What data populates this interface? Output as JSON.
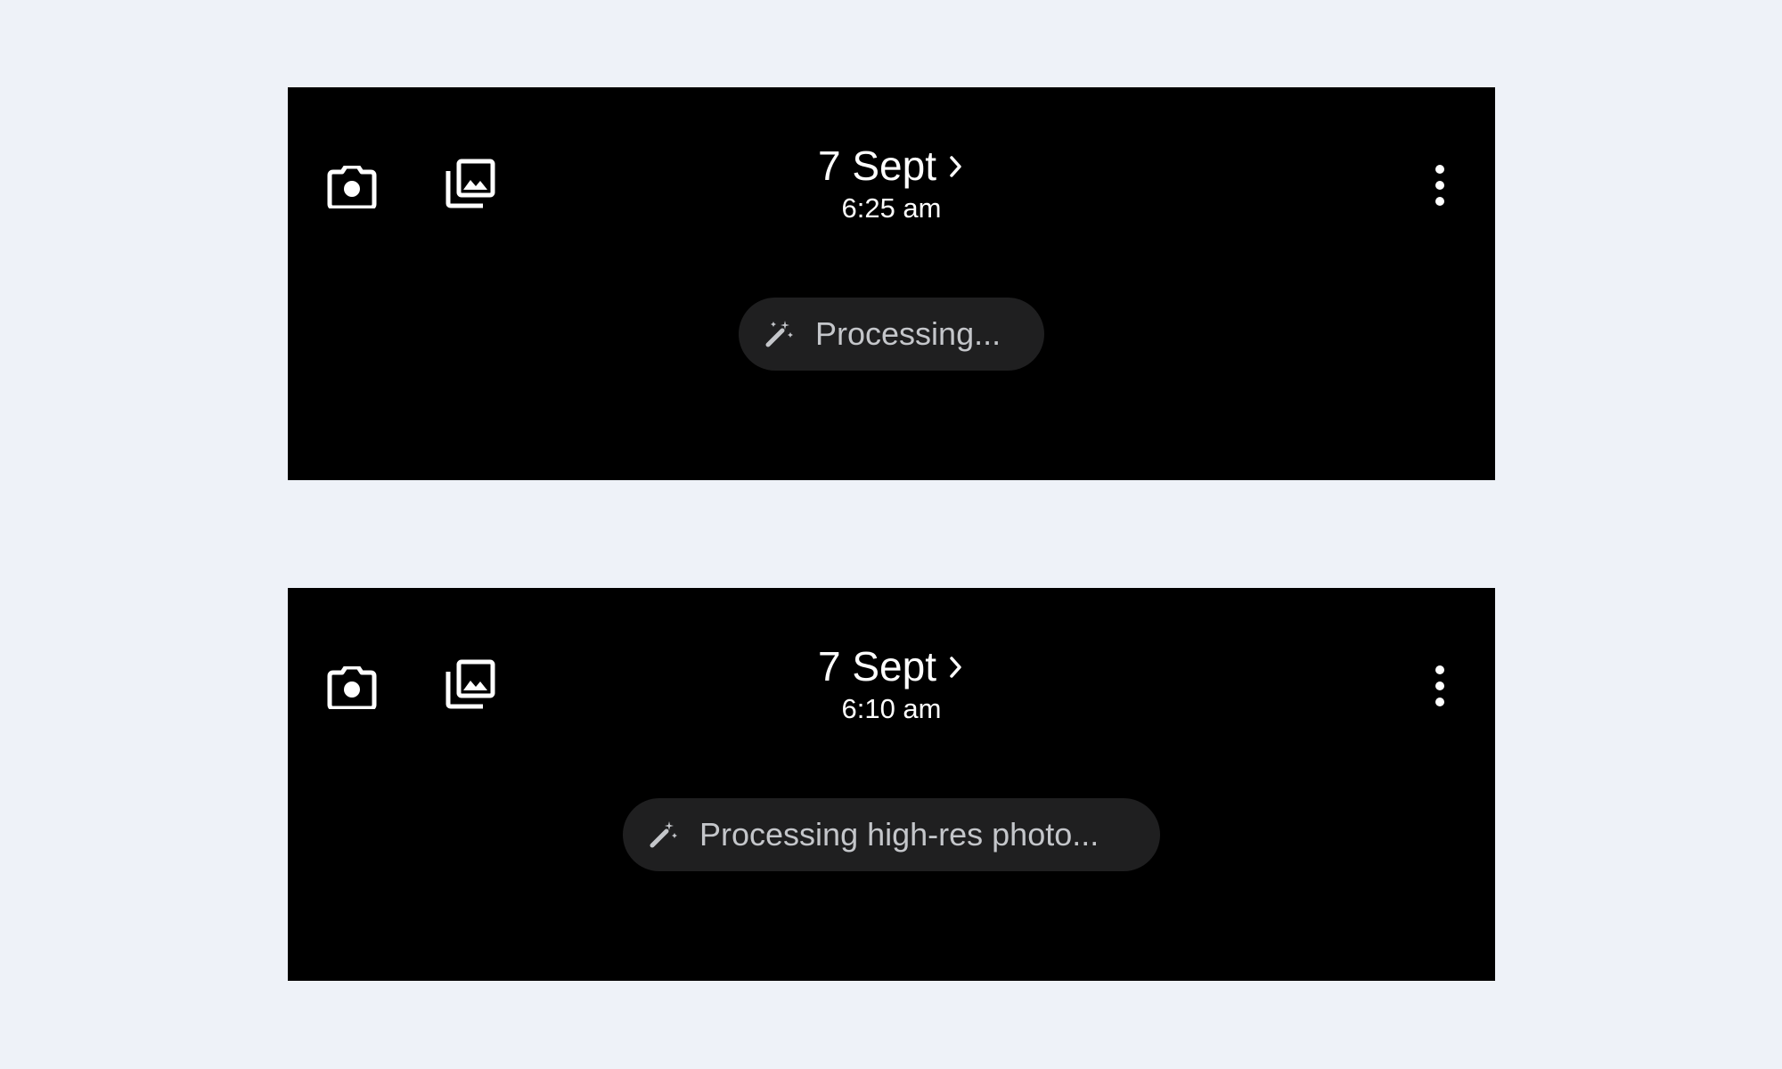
{
  "colors": {
    "page_background": "#eef2f8",
    "panel_background": "#000000",
    "pill_background": "#1f1f20",
    "pill_text": "#c4c6ca",
    "foreground": "#ffffff"
  },
  "icons": {
    "camera": "camera-icon",
    "gallery": "gallery-icon",
    "more": "more-vert-icon",
    "chevron": "chevron-right-icon",
    "processing": "magic-wand-icon"
  },
  "panels": [
    {
      "date": "7 Sept",
      "time": "6:25 am",
      "status": "Processing..."
    },
    {
      "date": "7 Sept",
      "time": "6:10 am",
      "status": "Processing high-res photo..."
    }
  ]
}
